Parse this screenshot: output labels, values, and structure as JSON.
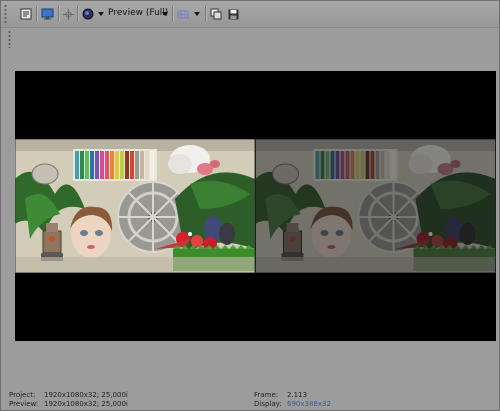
{
  "toolbar": {
    "preview_quality": "Preview (Full)"
  },
  "status": {
    "project_label": "Project:",
    "project_value": "1920x1080x32; 25,000i",
    "preview_label": "Preview:",
    "preview_value": "1920x1080x32; 25,000i",
    "frame_label": "Frame:",
    "frame_value": "2.113",
    "display_label": "Display:",
    "display_value": "690x388x32"
  },
  "icons": {
    "properties": "properties-icon",
    "external_monitor": "monitor-icon",
    "split_screen": "split-screen-icon",
    "preview_quality": "circle-icon",
    "overlays": "overlays-icon",
    "copy_snapshot": "copy-snapshot-icon",
    "save_snapshot": "save-icon"
  },
  "colors": {
    "panel_bg": "#9c9c9c",
    "stage_bg": "#000000",
    "display_value": "#3b56a8"
  }
}
